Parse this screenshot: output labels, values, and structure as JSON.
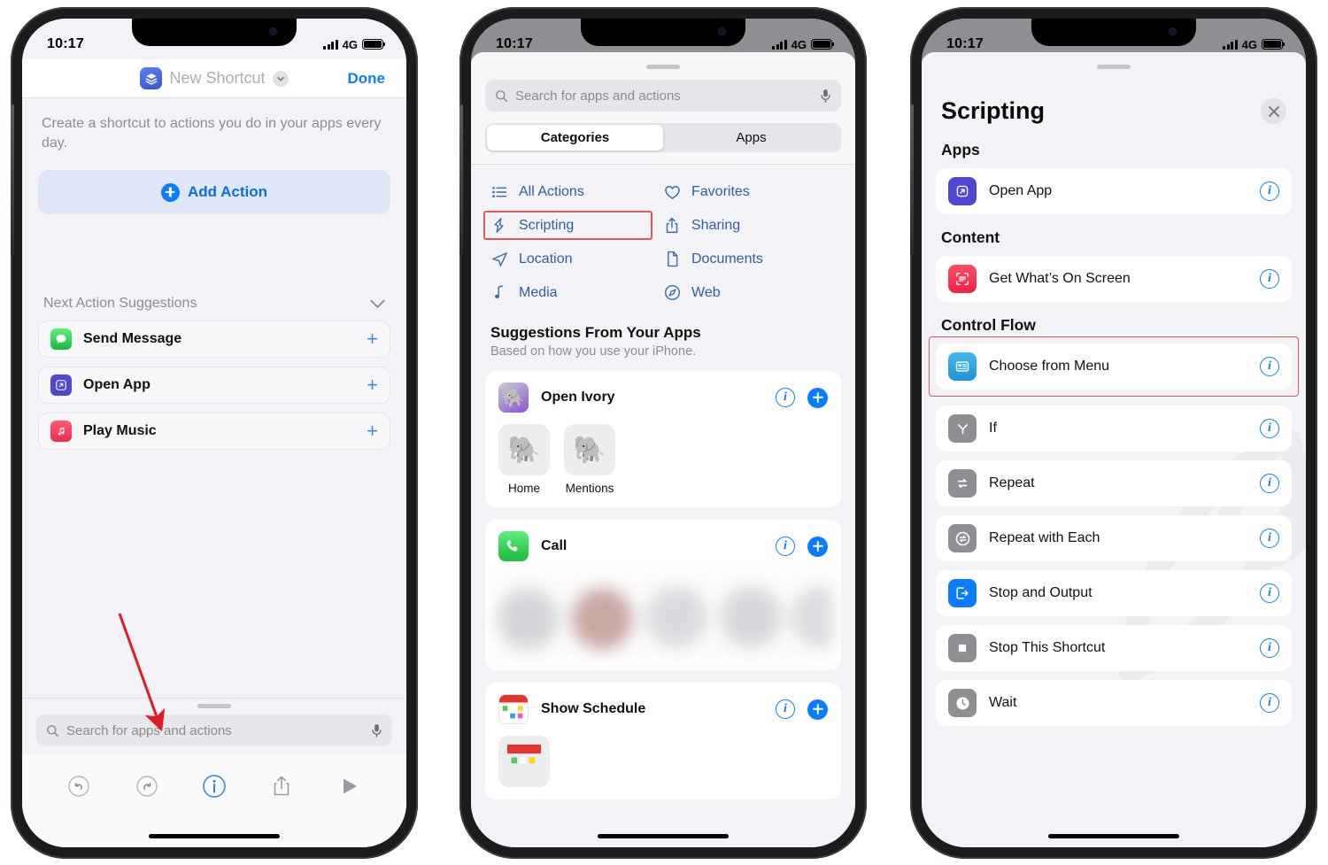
{
  "statusbar": {
    "time": "10:17",
    "network": "4G",
    "signal_icon": "cellular-bars-icon",
    "battery_icon": "battery-icon"
  },
  "phone1": {
    "nav": {
      "shortcut_icon": "shortcuts-app-icon",
      "title": "New Shortcut",
      "chevron_icon": "chevron-down-icon",
      "done_label": "Done"
    },
    "description": "Create a shortcut to actions you do in your apps every day.",
    "add_action": {
      "label": "Add Action",
      "icon": "plus-circle-icon"
    },
    "suggestions_header": {
      "label": "Next Action Suggestions",
      "chevron_icon": "chevron-down-icon"
    },
    "suggestions": [
      {
        "label": "Send Message",
        "icon": "messages-app-icon",
        "color": "#36c85a",
        "add_icon": "plus-icon"
      },
      {
        "label": "Open App",
        "icon": "open-app-icon",
        "color": "#5147d5",
        "add_icon": "plus-icon"
      },
      {
        "label": "Play Music",
        "icon": "music-app-icon",
        "color": "#f8405a",
        "add_icon": "plus-icon"
      }
    ],
    "search": {
      "placeholder": "Search for apps and actions",
      "search_icon": "search-icon",
      "mic_icon": "microphone-icon"
    },
    "toolbar": [
      {
        "name": "undo-button",
        "icon": "undo-icon"
      },
      {
        "name": "redo-button",
        "icon": "redo-icon"
      },
      {
        "name": "info-button",
        "icon": "info-circle-icon"
      },
      {
        "name": "share-button",
        "icon": "share-icon"
      },
      {
        "name": "play-button",
        "icon": "play-icon"
      }
    ],
    "annotation": {
      "type": "arrow",
      "color": "#e01b24"
    }
  },
  "phone2": {
    "search": {
      "placeholder": "Search for apps and actions",
      "search_icon": "search-icon",
      "mic_icon": "microphone-icon"
    },
    "segmented": {
      "options": [
        "Categories",
        "Apps"
      ],
      "selected": "Categories"
    },
    "categories": [
      {
        "label": "All Actions",
        "icon": "list-icon",
        "highlighted": false
      },
      {
        "label": "Favorites",
        "icon": "heart-icon",
        "highlighted": false
      },
      {
        "label": "Scripting",
        "icon": "scripting-icon",
        "highlighted": true
      },
      {
        "label": "Sharing",
        "icon": "share-icon",
        "highlighted": false
      },
      {
        "label": "Location",
        "icon": "location-arrow-icon",
        "highlighted": false
      },
      {
        "label": "Documents",
        "icon": "document-icon",
        "highlighted": false
      },
      {
        "label": "Media",
        "icon": "music-note-icon",
        "highlighted": false
      },
      {
        "label": "Web",
        "icon": "compass-icon",
        "highlighted": false
      }
    ],
    "suggestions_section": {
      "title": "Suggestions From Your Apps",
      "subtitle": "Based on how you use your iPhone."
    },
    "cards": [
      {
        "title": "Open Ivory",
        "icon": "ivory-app-icon",
        "info_icon": "info-circle-icon",
        "add_icon": "plus-circle-icon",
        "tiles": [
          {
            "label": "Home",
            "icon": "ivory-app-icon"
          },
          {
            "label": "Mentions",
            "icon": "ivory-app-icon"
          }
        ]
      },
      {
        "title": "Call",
        "icon": "phone-app-icon",
        "info_icon": "info-circle-icon",
        "add_icon": "plus-circle-icon",
        "blurred_contacts": true
      },
      {
        "title": "Show Schedule",
        "icon": "calendar-app-icon",
        "info_icon": "info-circle-icon",
        "add_icon": "plus-circle-icon"
      }
    ]
  },
  "phone3": {
    "header": {
      "title": "Scripting",
      "close_icon": "close-icon"
    },
    "sections": [
      {
        "heading": "Apps",
        "items": [
          {
            "label": "Open App",
            "icon": "open-app-icon",
            "color": "#5147d5",
            "info_icon": "info-circle-icon",
            "highlighted": false
          }
        ]
      },
      {
        "heading": "Content",
        "items": [
          {
            "label": "Get What’s On Screen",
            "icon": "screen-scan-icon",
            "color": "#f53a5a",
            "info_icon": "info-circle-icon",
            "highlighted": false
          }
        ]
      },
      {
        "heading": "Control Flow",
        "items": [
          {
            "label": "Choose from Menu",
            "icon": "menu-list-icon",
            "color": "#2aa3e0",
            "info_icon": "info-circle-icon",
            "highlighted": true
          },
          {
            "label": "If",
            "icon": "branch-icon",
            "color": "#8e8e93",
            "info_icon": "info-circle-icon",
            "highlighted": false
          },
          {
            "label": "Repeat",
            "icon": "repeat-icon",
            "color": "#8e8e93",
            "info_icon": "info-circle-icon",
            "highlighted": false
          },
          {
            "label": "Repeat with Each",
            "icon": "repeat-circle-icon",
            "color": "#8e8e93",
            "info_icon": "info-circle-icon",
            "highlighted": false
          },
          {
            "label": "Stop and Output",
            "icon": "stop-output-icon",
            "color": "#0a7cff",
            "info_icon": "info-circle-icon",
            "highlighted": false
          },
          {
            "label": "Stop This Shortcut",
            "icon": "stop-square-icon",
            "color": "#8e8e93",
            "info_icon": "info-circle-icon",
            "highlighted": false
          },
          {
            "label": "Wait",
            "icon": "clock-icon",
            "color": "#8e8e93",
            "info_icon": "info-circle-icon",
            "highlighted": false
          }
        ]
      }
    ]
  }
}
